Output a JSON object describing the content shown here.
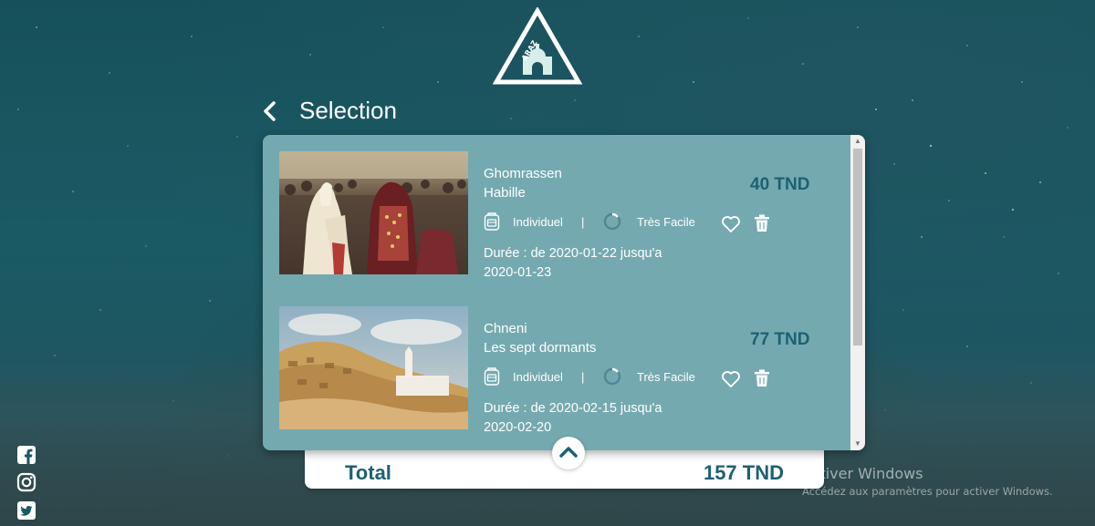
{
  "header": {
    "logo_text": "ARAZ",
    "title": "Selection"
  },
  "items": [
    {
      "city": "Ghomrassen",
      "name": "Habille",
      "price": "40 TND",
      "type": "Individuel",
      "separator": "|",
      "difficulty": "Très Facile",
      "date": "Durée : de 2020-01-22 jusqu'a 2020-01-23"
    },
    {
      "city": "Chneni",
      "name": "Les sept dormants",
      "price": "77 TND",
      "type": "Individuel",
      "separator": "|",
      "difficulty": "Très Facile",
      "date": "Durée : de 2020-02-15 jusqu'a 2020-02-20"
    }
  ],
  "total": {
    "label": "Total",
    "value": "157 TND"
  },
  "social": [
    "facebook-icon",
    "instagram-icon",
    "twitter-icon"
  ],
  "watermark": {
    "title": "Activer Windows",
    "subtitle": "Accédez aux paramètres pour activer Windows."
  },
  "colors": {
    "panel": "#74a9b0",
    "accent": "#1e6073",
    "background": "#1a5a64"
  }
}
